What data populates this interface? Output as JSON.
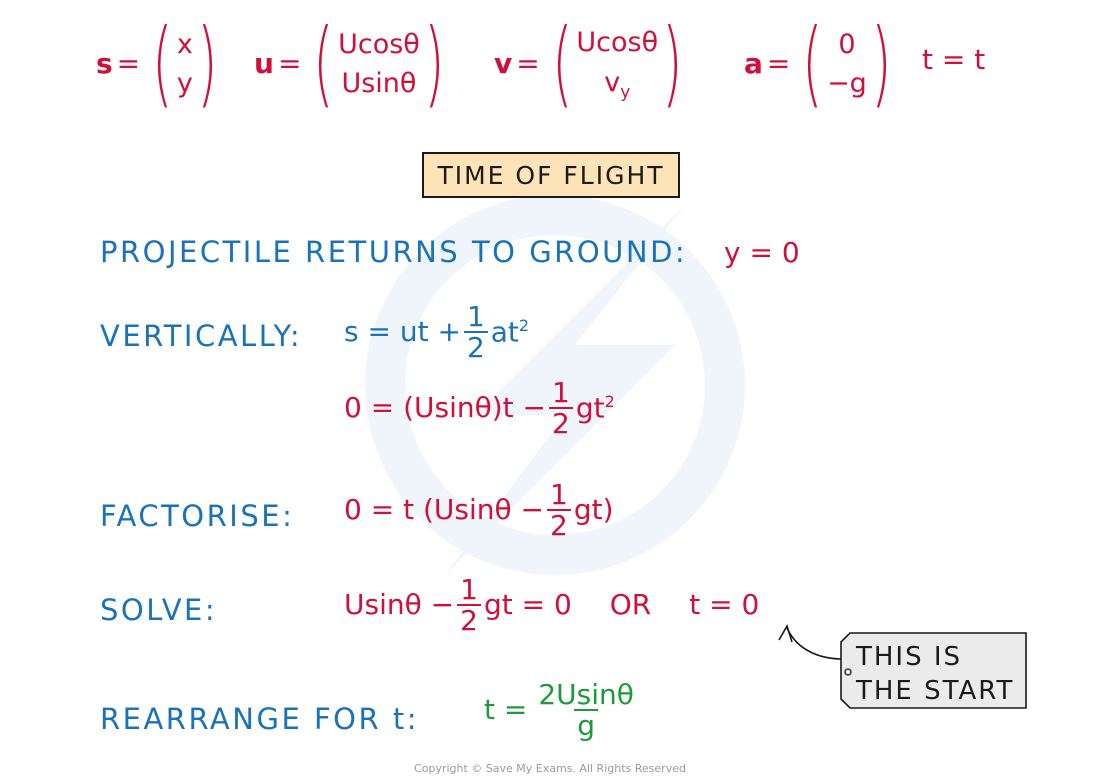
{
  "colors": {
    "red": "#d0103a",
    "blue": "#1a73b8",
    "green": "#1e9a3a",
    "title_box_fill": "#fde4b8",
    "tag_fill": "#ebebeb"
  },
  "vectors": [
    {
      "name": "s",
      "top": "x",
      "bottom": "y"
    },
    {
      "name": "u",
      "top": "Ucosθ",
      "bottom": "Usinθ"
    },
    {
      "name": "v",
      "top": "Ucosθ",
      "bottom_main": "v",
      "bottom_sub": "y"
    },
    {
      "name": "a",
      "top": "0",
      "bottom": "−g"
    }
  ],
  "time_def": "t = t",
  "equals": "=",
  "title": "TIME OF FLIGHT",
  "steps": {
    "ground": {
      "label": "PROJECTILE RETURNS TO GROUND:",
      "condition": "y = 0"
    },
    "vertically": {
      "label": "VERTICALLY:",
      "suvat_left": "s = ut +",
      "suvat_num": "1",
      "suvat_den": "2",
      "suvat_right": "at",
      "suvat_power": "2",
      "sub_left": "0 = (Usinθ)t −",
      "sub_num": "1",
      "sub_den": "2",
      "sub_right": "gt",
      "sub_power": "2"
    },
    "factorise": {
      "label": "FACTORISE:",
      "left": "0 = t (Usinθ −",
      "num": "1",
      "den": "2",
      "right": "gt)"
    },
    "solve": {
      "label": "SOLVE:",
      "left": "Usinθ −",
      "num": "1",
      "den": "2",
      "right": "gt = 0",
      "or": "OR",
      "alt": "t = 0"
    },
    "rearrange": {
      "label": "REARRANGE FOR t:",
      "left": "t =",
      "num": "2Usinθ",
      "den": "g"
    }
  },
  "note": {
    "line1": "THIS IS",
    "line2": "THE START"
  },
  "copyright": "Copyright © Save My Exams. All Rights Reserved"
}
